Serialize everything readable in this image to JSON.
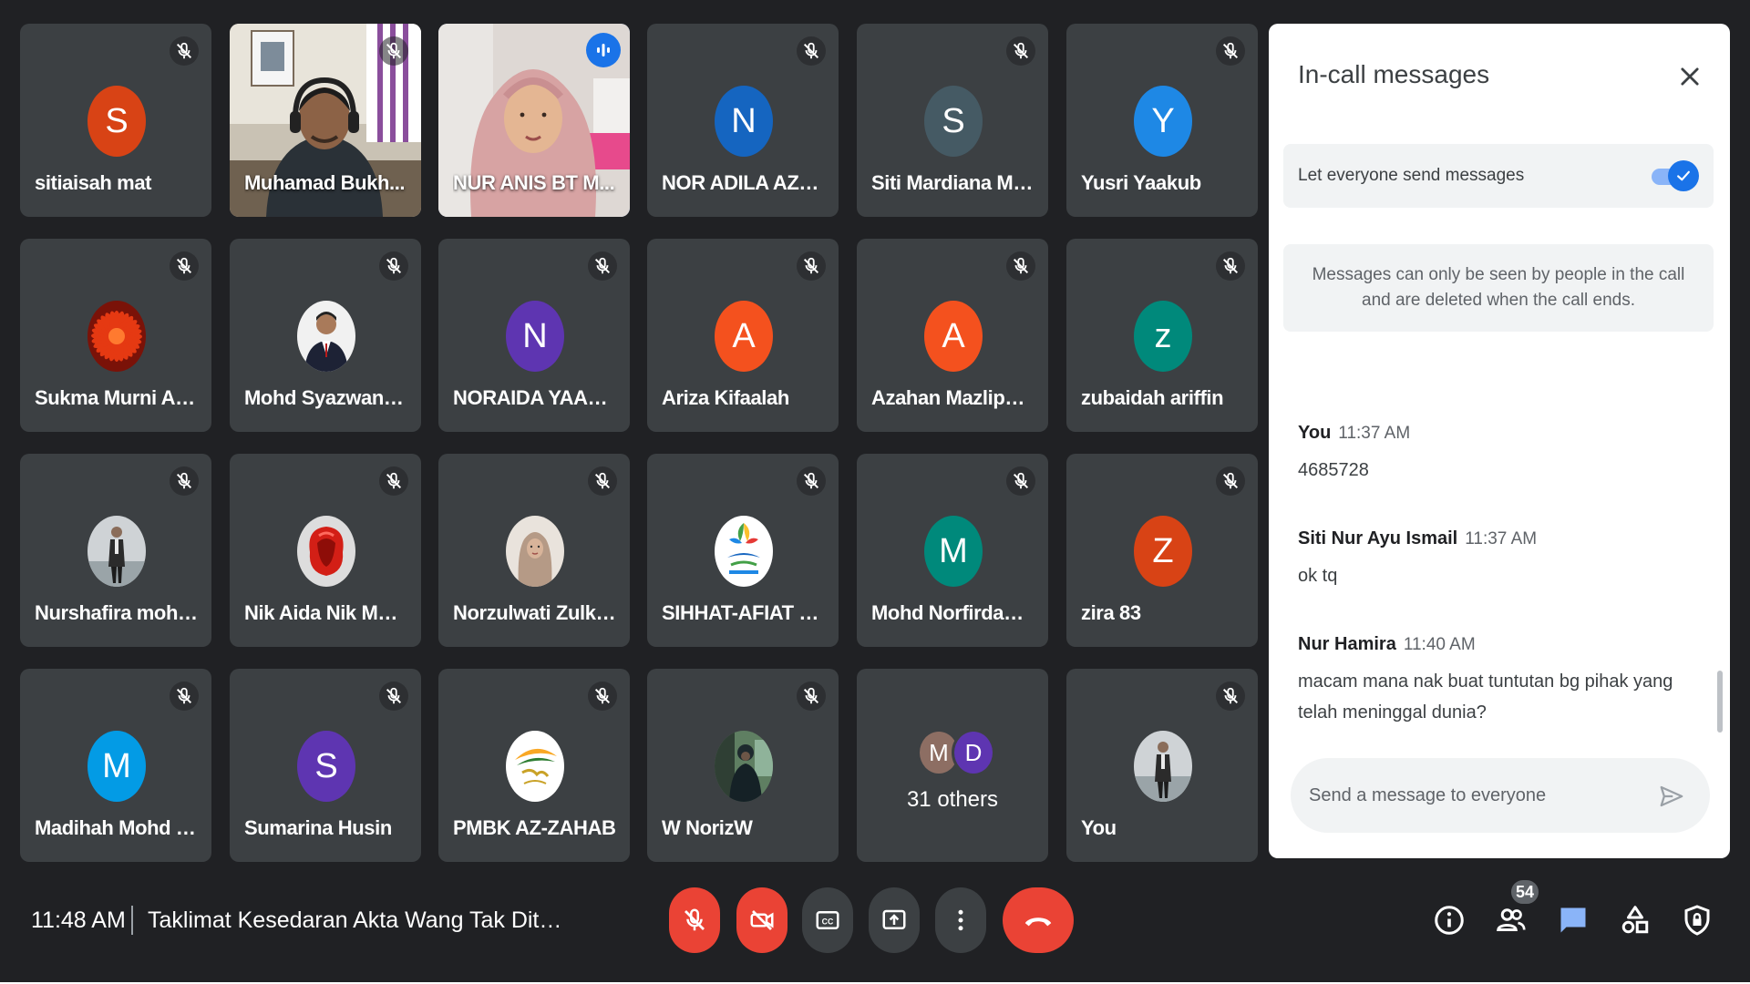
{
  "meeting": {
    "time": "11:48 AM",
    "title": "Taklimat Kesedaran Akta Wang Tak Dituntut..."
  },
  "participants": [
    {
      "name": "sitiaisah mat",
      "initial": "S",
      "color": "#d84315",
      "kind": "initial",
      "muted": true
    },
    {
      "name": "Muhamad Bukh...",
      "kind": "video-man",
      "muted": true
    },
    {
      "name": "NUR ANIS BT M...",
      "kind": "video-woman",
      "speaking": true
    },
    {
      "name": "NOR ADILA AZU...",
      "initial": "N",
      "color": "#1565c0",
      "kind": "initial",
      "muted": true
    },
    {
      "name": "Siti Mardiana Mo...",
      "initial": "S",
      "color": "#455a64",
      "kind": "initial",
      "muted": true
    },
    {
      "name": "Yusri Yaakub",
      "initial": "Y",
      "color": "#1e88e5",
      "kind": "initial",
      "muted": true
    },
    {
      "name": "Sukma Murni Ad...",
      "kind": "photo-flower",
      "muted": true
    },
    {
      "name": "Mohd Syazwan S...",
      "kind": "photo-suit",
      "muted": true
    },
    {
      "name": "NORAIDA YAAC...",
      "initial": "N",
      "color": "#5e35b1",
      "kind": "initial",
      "muted": true
    },
    {
      "name": "Ariza Kifaalah",
      "initial": "A",
      "color": "#f4511e",
      "kind": "initial",
      "muted": true
    },
    {
      "name": "Azahan Mazlipah...",
      "initial": "A",
      "color": "#f4511e",
      "kind": "initial",
      "muted": true
    },
    {
      "name": "zubaidah ariffin",
      "initial": "z",
      "color": "#00897b",
      "kind": "initial",
      "muted": true
    },
    {
      "name": "Nurshafira mohd ...",
      "kind": "photo-person",
      "muted": true
    },
    {
      "name": "Nik Aida Nik Moh...",
      "kind": "photo-red",
      "muted": true
    },
    {
      "name": "Norzulwati Zulkifli",
      "kind": "photo-hijab",
      "muted": true
    },
    {
      "name": "SIHHAT-AFIAT S...",
      "kind": "photo-logo",
      "muted": true
    },
    {
      "name": "Mohd Norfirdaus ...",
      "initial": "M",
      "color": "#00897b",
      "kind": "initial",
      "muted": true
    },
    {
      "name": "zira 83",
      "initial": "Z",
      "color": "#d84315",
      "kind": "initial",
      "muted": true
    },
    {
      "name": "Madihah Mohd R...",
      "initial": "M",
      "color": "#039be5",
      "kind": "initial",
      "muted": true
    },
    {
      "name": "Sumarina Husin",
      "initial": "S",
      "color": "#5e35b1",
      "kind": "initial",
      "muted": true
    },
    {
      "name": "PMBK AZ-ZAHAB",
      "kind": "photo-logo2",
      "muted": true
    },
    {
      "name": "W NorizW",
      "kind": "photo-dark",
      "muted": true
    },
    {
      "name": "31 others",
      "kind": "others",
      "others": [
        {
          "initial": "M",
          "color": "#8d6e63"
        },
        {
          "initial": "D",
          "color": "#5e35b1"
        }
      ]
    },
    {
      "name": "You",
      "kind": "photo-person",
      "muted": true
    }
  ],
  "panel": {
    "title": "In-call messages",
    "toggle_label": "Let everyone send messages",
    "toggle_on": true,
    "info": "Messages can only be seen by people in the call and are deleted when the call ends.",
    "messages": [
      {
        "sender": "You",
        "time": "11:37 AM",
        "text": "4685728"
      },
      {
        "sender": "Siti Nur Ayu Ismail",
        "time": "11:37 AM",
        "text": "ok tq"
      },
      {
        "sender": "Nur Hamira",
        "time": "11:40 AM",
        "text": "macam mana nak buat tuntutan bg pihak yang telah meninggal dunia?"
      }
    ],
    "input_placeholder": "Send a message to everyone"
  },
  "toolbar": {
    "people_count": "54",
    "colors": {
      "red": "#ea4335",
      "grey": "#3c4043",
      "accent": "#1a73e8",
      "chat_active": "#8ab4f8"
    },
    "icons": [
      "mic-off-icon",
      "camera-off-icon",
      "captions-icon",
      "present-icon",
      "more-options-icon",
      "end-call-icon",
      "info-icon",
      "people-icon",
      "chat-icon",
      "activities-icon",
      "host-controls-icon"
    ]
  }
}
